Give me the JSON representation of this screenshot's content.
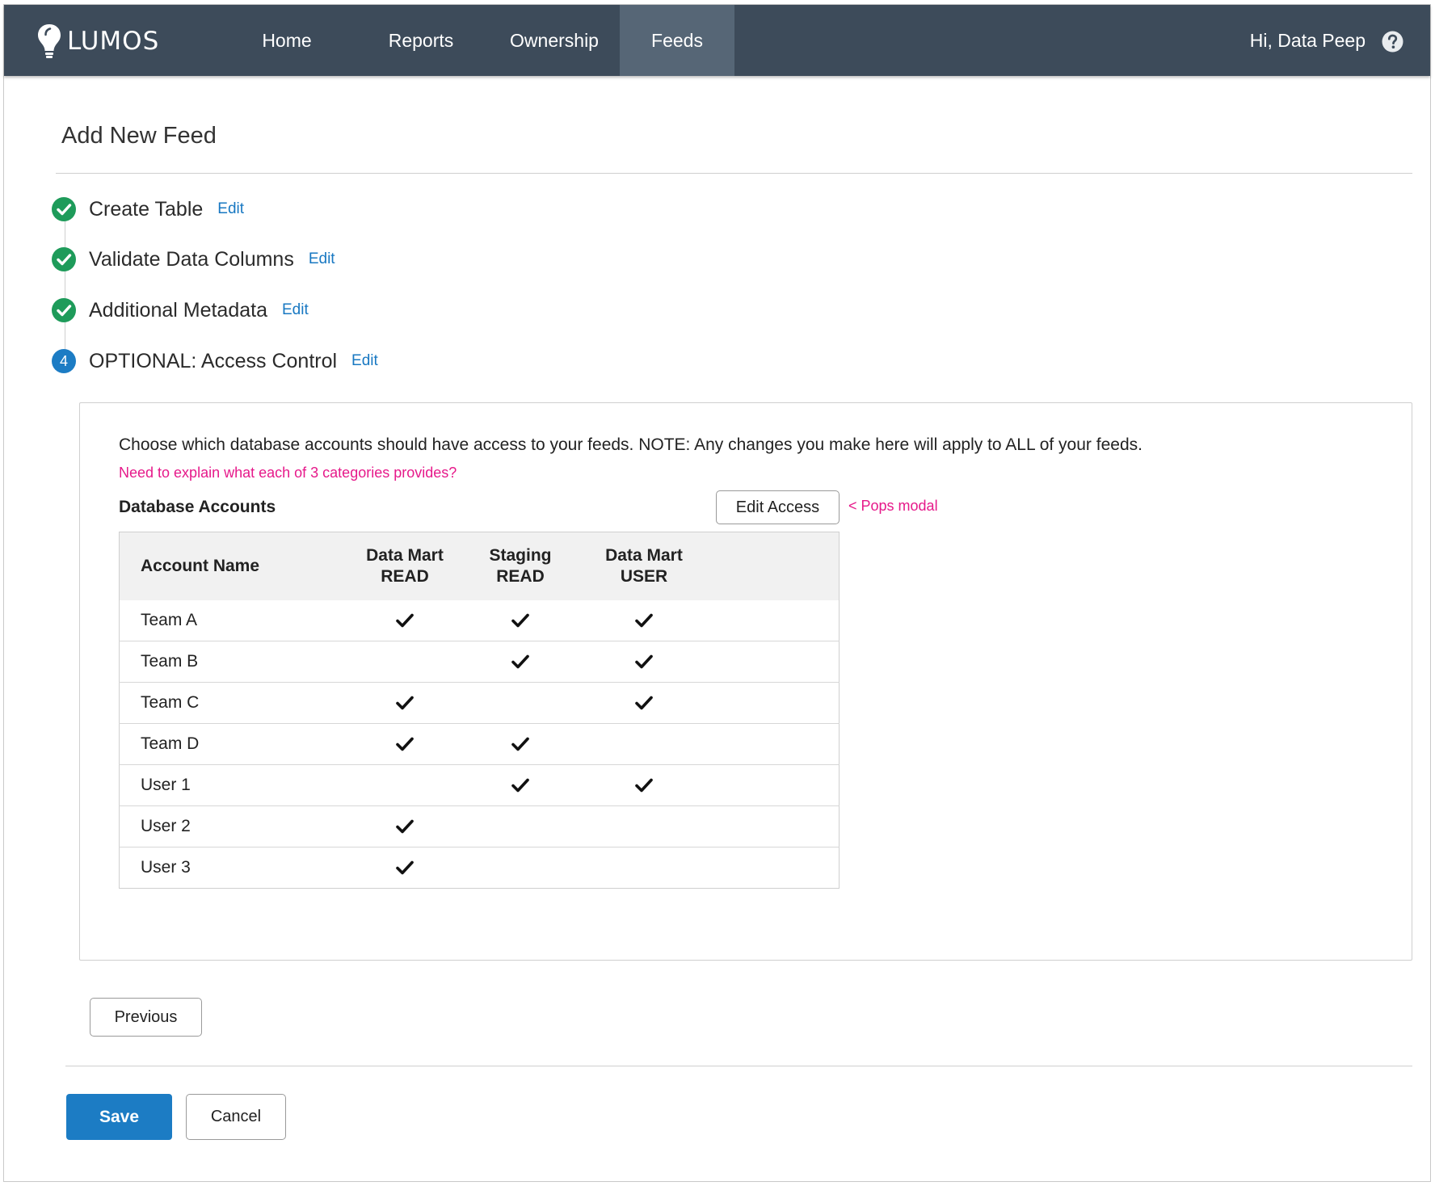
{
  "brand": {
    "name": "LUMOS",
    "logo_icon": "lightbulb-icon"
  },
  "nav": {
    "items": [
      {
        "label": "Home",
        "active": false
      },
      {
        "label": "Reports",
        "active": false
      },
      {
        "label": "Ownership",
        "active": false
      },
      {
        "label": "Feeds",
        "active": true
      }
    ],
    "greeting": "Hi, Data Peep",
    "help_icon": "question-circle-icon"
  },
  "page": {
    "title": "Add New Feed"
  },
  "steps": [
    {
      "label": "Create Table",
      "edit": "Edit",
      "status": "complete"
    },
    {
      "label": "Validate Data Columns",
      "edit": "Edit",
      "status": "complete"
    },
    {
      "label": "Additional Metadata",
      "edit": "Edit",
      "status": "complete"
    },
    {
      "label": "OPTIONAL: Access Control",
      "edit": "Edit",
      "status": "current",
      "number": "4"
    }
  ],
  "access": {
    "description": "Choose which database accounts should have access to your feeds. NOTE: Any changes you make here will apply to ALL of your feeds.",
    "note": "Need to explain what each of 3 categories provides?",
    "section_title": "Database Accounts",
    "edit_button": "Edit Access",
    "annotation": "< Pops modal",
    "table": {
      "headers": {
        "name": "Account Name",
        "col1": [
          "Data Mart",
          "READ"
        ],
        "col2": [
          "Staging",
          "READ"
        ],
        "col3": [
          "Data Mart",
          "USER"
        ]
      },
      "rows": [
        {
          "name": "Team A",
          "checks": [
            true,
            true,
            true
          ]
        },
        {
          "name": "Team B",
          "checks": [
            false,
            true,
            true
          ]
        },
        {
          "name": "Team C",
          "checks": [
            true,
            false,
            true
          ]
        },
        {
          "name": "Team D",
          "checks": [
            true,
            true,
            false
          ]
        },
        {
          "name": "User 1",
          "checks": [
            false,
            true,
            true
          ]
        },
        {
          "name": "User 2",
          "checks": [
            true,
            false,
            false
          ]
        },
        {
          "name": "User 3",
          "checks": [
            true,
            false,
            false
          ]
        }
      ]
    }
  },
  "actions": {
    "previous": "Previous",
    "save": "Save",
    "cancel": "Cancel"
  },
  "colors": {
    "nav_bg": "#3d4b5a",
    "nav_active": "#566676",
    "success_green": "#1e9b5a",
    "primary_blue": "#1c7cc4",
    "link_blue": "#1878c2",
    "annotation_pink": "#e6198a"
  }
}
